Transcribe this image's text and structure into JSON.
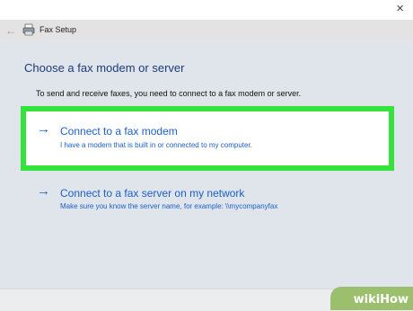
{
  "window": {
    "close_glyph": "×"
  },
  "header": {
    "back_icon": "back-arrow-icon",
    "app_icon": "fax-icon",
    "title": "Fax Setup"
  },
  "main": {
    "heading": "Choose a fax modem or server",
    "description": "To send and receive faxes, you need to connect to a fax modem or server.",
    "options": [
      {
        "arrow": "→",
        "title": "Connect to a fax modem",
        "subtitle": "I have a modem that is built in or connected to my computer.",
        "highlighted": true
      },
      {
        "arrow": "→",
        "title": "Connect to a fax server on my network",
        "subtitle": "Make sure you know the server name, for example: \\\\mycompanyfax",
        "highlighted": false
      }
    ]
  },
  "watermark": {
    "text": "wikiHow"
  },
  "colors": {
    "link": "#1d5fc6",
    "heading": "#1e3b78",
    "highlight": "#35e33c",
    "background": "#dfe5ea"
  }
}
